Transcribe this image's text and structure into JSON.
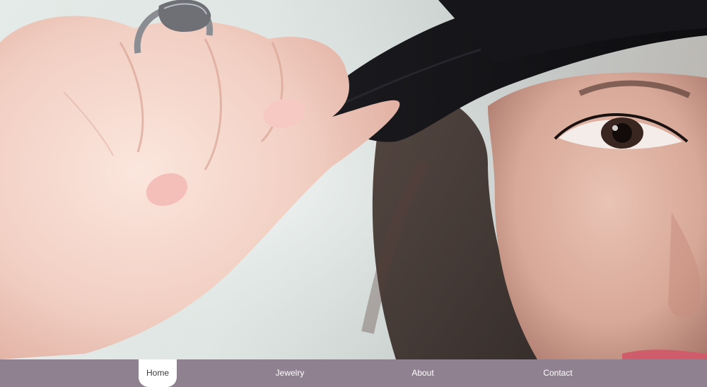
{
  "hero": {
    "image_semantic": "hero-photo"
  },
  "nav": {
    "items": [
      {
        "label": "Home",
        "active": true
      },
      {
        "label": "Jewelry",
        "active": false
      },
      {
        "label": "About",
        "active": false
      },
      {
        "label": "Contact",
        "active": false
      }
    ]
  },
  "colors": {
    "nav_background": "#8f8190",
    "nav_text": "#ffffff",
    "active_tab_background": "#ffffff",
    "active_tab_text": "#3a3a3a"
  }
}
